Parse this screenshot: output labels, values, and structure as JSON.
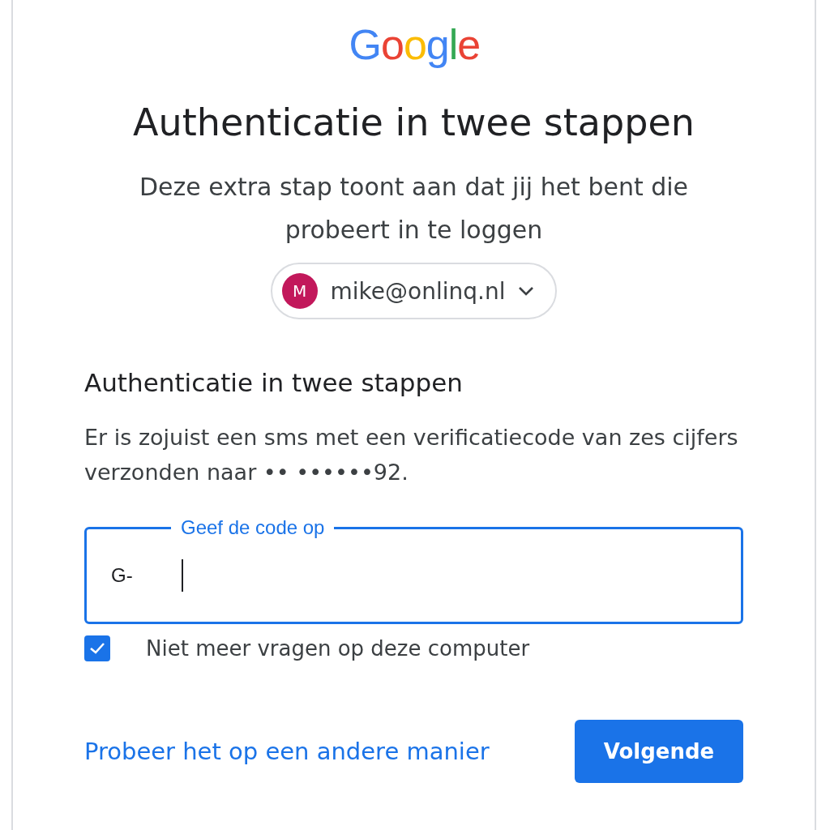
{
  "logo": {
    "text": "Google"
  },
  "title": "Authenticatie in twee stappen",
  "subtitle": "Deze extra stap toont aan dat jij het bent die probeert in te loggen",
  "account": {
    "initial": "M",
    "email": "mike@onlinq.nl"
  },
  "section": {
    "heading": "Authenticatie in twee stappen",
    "message": "Er is zojuist een sms met een verificatiecode van zes cijfers verzonden naar •• ••••••92."
  },
  "code_field": {
    "label": "Geef de code op",
    "prefix": "G-",
    "focused": true
  },
  "remember": {
    "label": "Niet meer vragen op deze computer",
    "checked": true
  },
  "other_way_link": "Probeer het op een andere manier",
  "next_button": "Volgende"
}
